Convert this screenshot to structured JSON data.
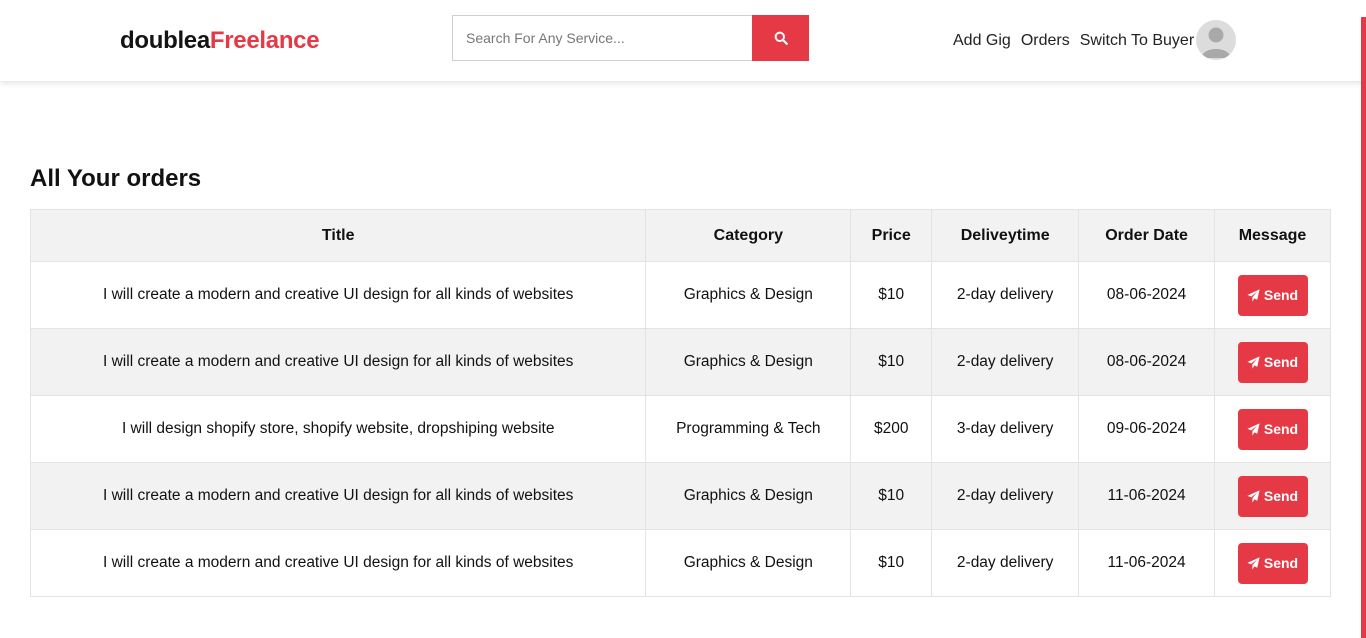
{
  "header": {
    "logo_part1": "doublea",
    "logo_part2": "Freelance",
    "search_placeholder": "Search For Any Service...",
    "nav": {
      "add_gig": "Add Gig",
      "orders": "Orders",
      "switch": "Switch To Buyer"
    }
  },
  "page": {
    "title": "All Your orders"
  },
  "table": {
    "headers": {
      "title": "Title",
      "category": "Category",
      "price": "Price",
      "delivery": "Deliveytime",
      "order_date": "Order Date",
      "message": "Message"
    },
    "rows": [
      {
        "title": "I will create a modern and creative UI design for all kinds of websites",
        "category": "Graphics & Design",
        "price": "$10",
        "delivery": "2-day delivery",
        "date": "08-06-2024",
        "action": "Send"
      },
      {
        "title": "I will create a modern and creative UI design for all kinds of websites",
        "category": "Graphics & Design",
        "price": "$10",
        "delivery": "2-day delivery",
        "date": "08-06-2024",
        "action": "Send"
      },
      {
        "title": "I will design shopify store, shopify website, dropshiping website",
        "category": "Programming & Tech",
        "price": "$200",
        "delivery": "3-day delivery",
        "date": "09-06-2024",
        "action": "Send"
      },
      {
        "title": "I will create a modern and creative UI design for all kinds of websites",
        "category": "Graphics & Design",
        "price": "$10",
        "delivery": "2-day delivery",
        "date": "11-06-2024",
        "action": "Send"
      },
      {
        "title": "I will create a modern and creative UI design for all kinds of websites",
        "category": "Graphics & Design",
        "price": "$10",
        "delivery": "2-day delivery",
        "date": "11-06-2024",
        "action": "Send"
      }
    ]
  },
  "icons": {
    "search": "search-icon",
    "avatar": "user-avatar-icon",
    "send": "paper-plane-icon"
  },
  "colors": {
    "accent": "#e63946",
    "header_bg": "#ffffff",
    "row_alt": "#f2f2f2"
  }
}
